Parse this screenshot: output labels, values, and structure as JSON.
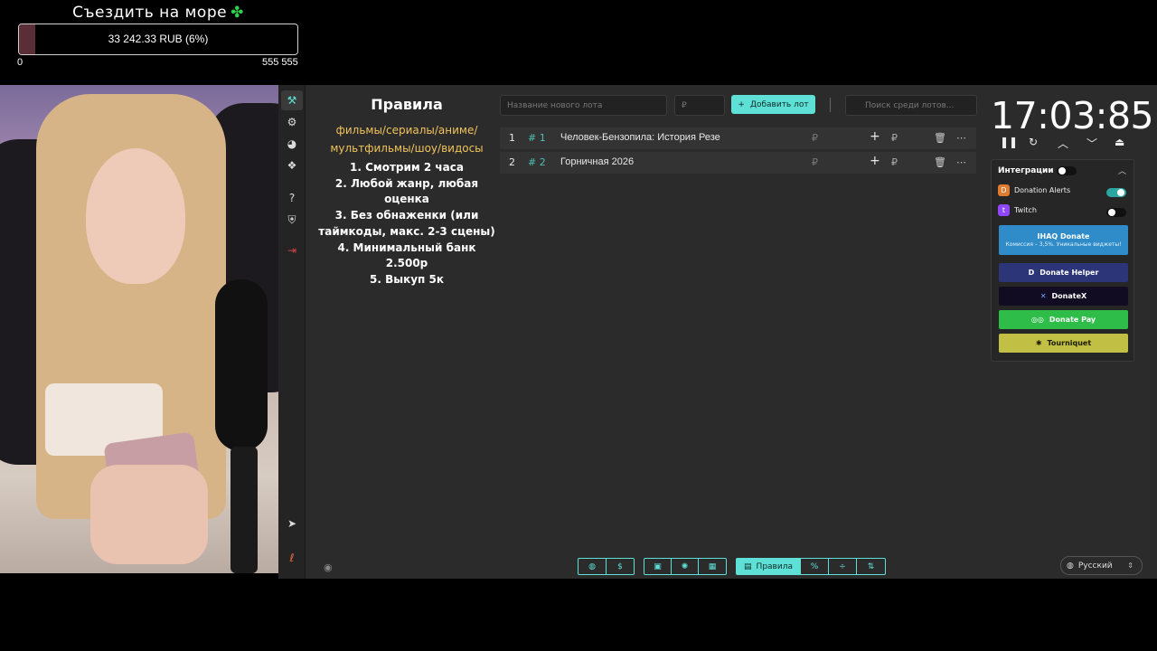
{
  "goal": {
    "title": "Съездить на море",
    "amount_text": "33 242.33 RUB (6%)",
    "progress_fraction": 0.06,
    "min": "0",
    "max": "555 555"
  },
  "rules": {
    "title": "Правила",
    "genres_line1": "фильмы/сериалы/аниме/",
    "genres_line2": "мультфильмы/шоу/видосы",
    "items": [
      "1. Смотрим 2 часа",
      "2. Любой жанр, любая",
      "оценка",
      "3. Без обнаженки (или",
      "таймкоды, макс. 2-3 сцены)",
      "4. Минимальный банк",
      "2.500р",
      "5. Выкуп 5к"
    ]
  },
  "lot_form": {
    "name_placeholder": "Название нового лота",
    "amount_placeholder": "₽",
    "add_label": "Добавить лот",
    "search_placeholder": "Поиск среди лотов..."
  },
  "lots": [
    {
      "index": "1",
      "hash": "# 1",
      "name": "Человек-Бензопила: История Резе",
      "currency": "₽"
    },
    {
      "index": "2",
      "hash": "# 2",
      "name": "Горничная 2026",
      "currency": "₽"
    }
  ],
  "timer": {
    "value": "17:03:85"
  },
  "integrations": {
    "title": "Интеграции",
    "donation_alerts": "Donation Alerts",
    "twitch": "Twitch",
    "ihaq_label": "IHAQ Donate",
    "ihaq_sub": "Комиссия – 3,5%. Уникальные виджеты!",
    "donate_helper": "Donate Helper",
    "donatex": "DonateX",
    "donate_pay": "Donate Pay",
    "tourniquet": "Tourniquet"
  },
  "toolbar": {
    "rules_label": "Правила",
    "percent_label": "%"
  },
  "language": {
    "selected": "Русский"
  }
}
